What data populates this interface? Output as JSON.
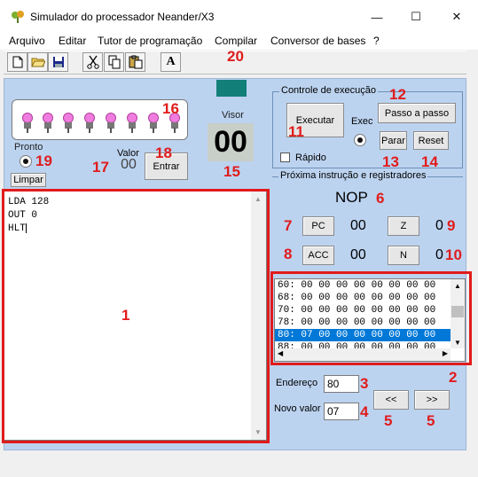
{
  "window": {
    "title": "Simulador do processador Neander/X3",
    "minimize": "—",
    "maximize": "☐",
    "close": "✕"
  },
  "menu": [
    "Arquivo",
    "Editar",
    "Tutor de programação",
    "Compilar",
    "Conversor de bases",
    "?"
  ],
  "toolbar": {
    "icons": [
      "new-file-icon",
      "open-folder-icon",
      "save-icon",
      "cut-icon",
      "copy-icon",
      "paste-icon",
      "font-icon"
    ],
    "font_glyph": "A"
  },
  "display": {
    "visor_label": "Visor",
    "visor_value": "00",
    "pronto_label": "Pronto",
    "limpar": "Limpar",
    "valor_label": "Valor",
    "valor_value": "00",
    "entrar": "Entrar"
  },
  "editor": {
    "lines": [
      "LDA 128",
      "OUT 0",
      "HLT"
    ]
  },
  "exec_control": {
    "title": "Controle de execução",
    "executar": "Executar",
    "exec_label": "Exec",
    "passo_a_passo": "Passo a passo",
    "parar": "Parar",
    "reset": "Reset",
    "rapido": "Rápido"
  },
  "registers": {
    "title": "Próxima instrução e registradores",
    "next_instruction": "NOP",
    "pc_label": "PC",
    "pc_value": "00",
    "z_label": "Z",
    "z_value": "0",
    "acc_label": "ACC",
    "acc_value": "00",
    "n_label": "N",
    "n_value": "0"
  },
  "memory": {
    "rows": [
      "60: 00 00 00 00 00 00 00 00",
      "68: 00 00 00 00 00 00 00 00",
      "70: 00 00 00 00 00 00 00 00",
      "78: 00 00 00 00 00 00 00 00",
      "80: 07 00 00 00 00 00 00 00",
      "88: 00 00 00 00 00 00 00 00"
    ],
    "selected_index": 4
  },
  "memory_edit": {
    "endereco_label": "Endereço",
    "endereco_value": "80",
    "novo_valor_label": "Novo valor",
    "novo_valor_value": "07",
    "prev": "<<",
    "next": ">>"
  },
  "annotations": {
    "n1": "1",
    "n2": "2",
    "n3": "3",
    "n4": "4",
    "n5a": "5",
    "n5b": "5",
    "n6": "6",
    "n7": "7",
    "n8": "8",
    "n9": "9",
    "n10": "10",
    "n11": "11",
    "n12": "12",
    "n13": "13",
    "n14": "14",
    "n15": "15",
    "n16": "16",
    "n17": "17",
    "n18": "18",
    "n19": "19",
    "n20": "20"
  },
  "colors": {
    "panel": "#bcd3f0",
    "led": "#f07ce0",
    "annotation": "#e01c1c",
    "selection": "#0078d7"
  }
}
